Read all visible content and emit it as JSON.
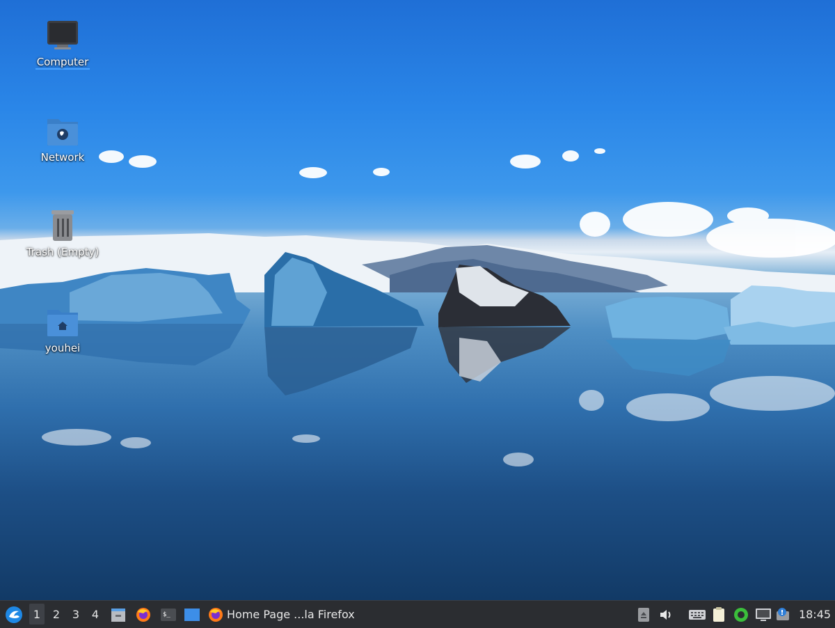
{
  "desktop": {
    "icons": [
      {
        "label": "Computer",
        "icon": "computer-icon"
      },
      {
        "label": "Network",
        "icon": "network-folder-icon"
      },
      {
        "label": "Trash (Empty)",
        "icon": "trash-icon"
      },
      {
        "label": "youhei",
        "icon": "home-folder-icon"
      }
    ]
  },
  "taskbar": {
    "menu_icon": "lubuntu-start-icon",
    "workspaces": [
      "1",
      "2",
      "3",
      "4"
    ],
    "active_workspace": "1",
    "quicklaunch": [
      "file-manager-icon",
      "firefox-icon",
      "terminal-icon",
      "show-desktop-icon"
    ],
    "window_button": {
      "label": "Home Page ...la Firefox",
      "icon": "firefox-icon"
    },
    "tray": [
      "eject-icon",
      "volume-icon",
      "keyboard-icon",
      "clipboard-icon",
      "network-status-icon",
      "display-icon",
      "notification-icon"
    ],
    "clock": "18:45"
  },
  "colors": {
    "taskbar_bg": "#2b2d31",
    "folder_blue": "#4a90d9",
    "accent": "#4aa3ff"
  }
}
